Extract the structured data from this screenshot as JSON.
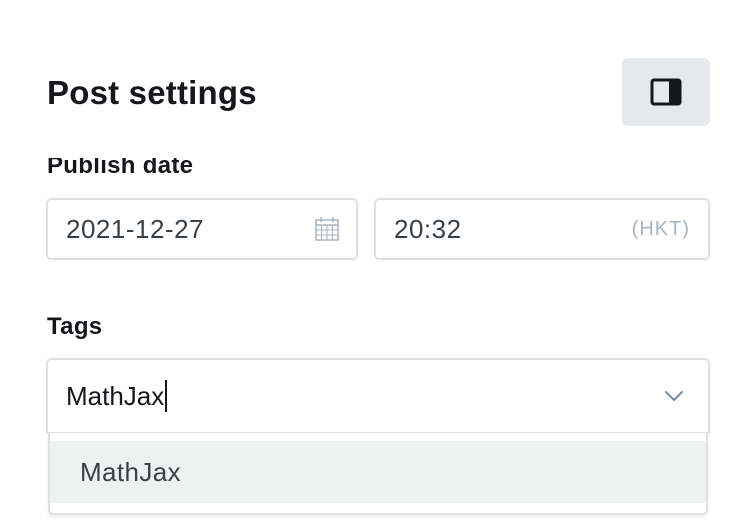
{
  "panel": {
    "title": "Post settings",
    "toggle_icon": "sidebar-toggle-icon"
  },
  "publish": {
    "label": "Publish date",
    "date_value": "2021-12-27",
    "date_icon": "calendar-icon",
    "time_value": "20:32",
    "timezone": "(HKT)"
  },
  "tags": {
    "label": "Tags",
    "input_value": "MathJax",
    "chevron_icon": "chevron-down-icon",
    "options": [
      {
        "label": "MathJax"
      }
    ]
  }
}
